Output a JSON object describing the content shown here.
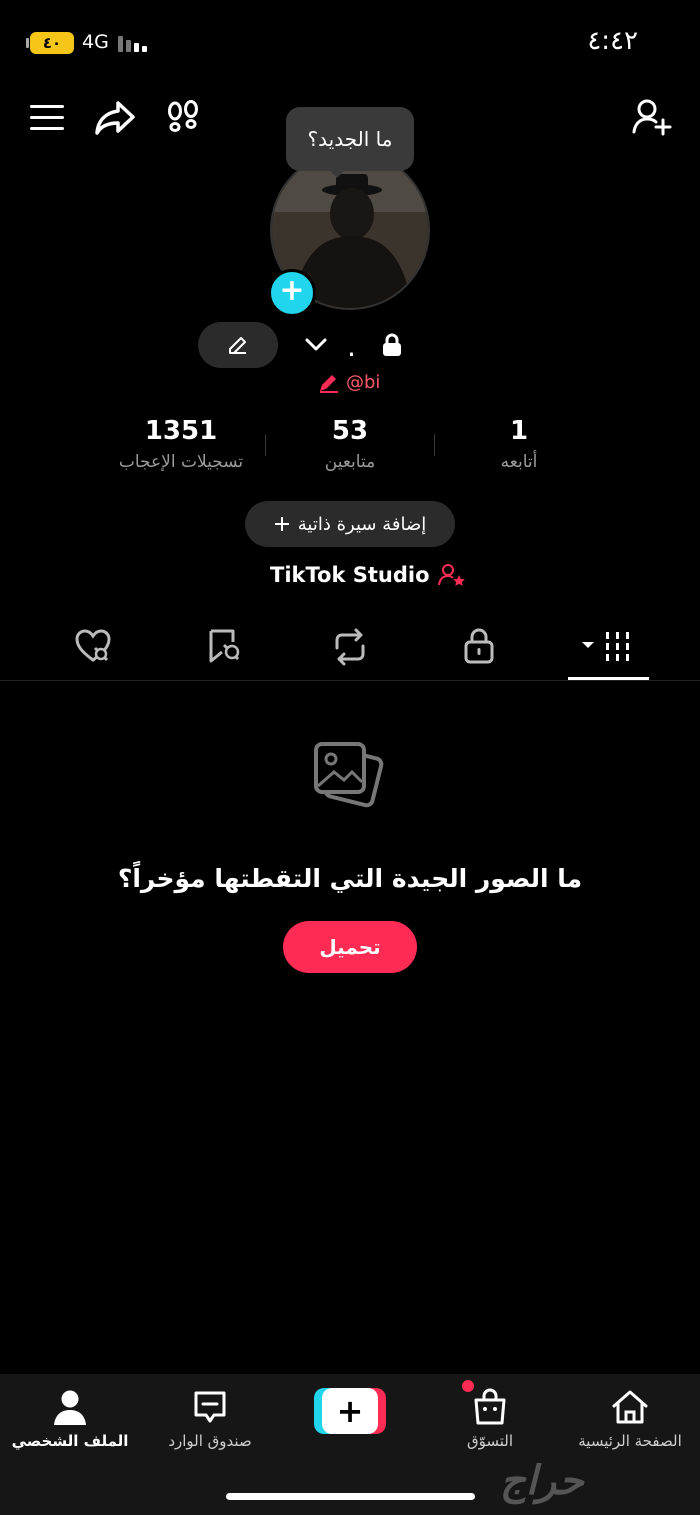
{
  "status_bar": {
    "time": "٤:٤٢",
    "battery": "٤٠",
    "network": "4G"
  },
  "tooltip": {
    "text": "ما الجديد؟"
  },
  "profile": {
    "name": ".",
    "handle": "@bi",
    "stats": [
      {
        "value": "1351",
        "label": "تسجيلات الإعجاب"
      },
      {
        "value": "53",
        "label": "متابعين"
      },
      {
        "value": "1",
        "label": "أتابعه"
      }
    ],
    "add_bio_label": "إضافة سيرة ذاتية",
    "studio_label": "TikTok Studio"
  },
  "tabs": [
    {
      "icon": "liked-hidden-icon"
    },
    {
      "icon": "favorites-hidden-icon"
    },
    {
      "icon": "repost-icon"
    },
    {
      "icon": "lock-icon"
    },
    {
      "icon": "grid-icon",
      "active": true
    }
  ],
  "empty_state": {
    "title": "ما الصور الجيدة التي التقطتها مؤخراً؟",
    "button": "تحميل"
  },
  "bottom_nav": {
    "profile": "الملف الشخصي",
    "inbox": "صندوق الوارد",
    "create": "+",
    "shop": "التسوّق",
    "home": "الصفحة الرئيسية"
  },
  "watermark": "حراج",
  "colors": {
    "accent": "#fe2c55",
    "cyan": "#20d5ec",
    "background": "#000000"
  }
}
